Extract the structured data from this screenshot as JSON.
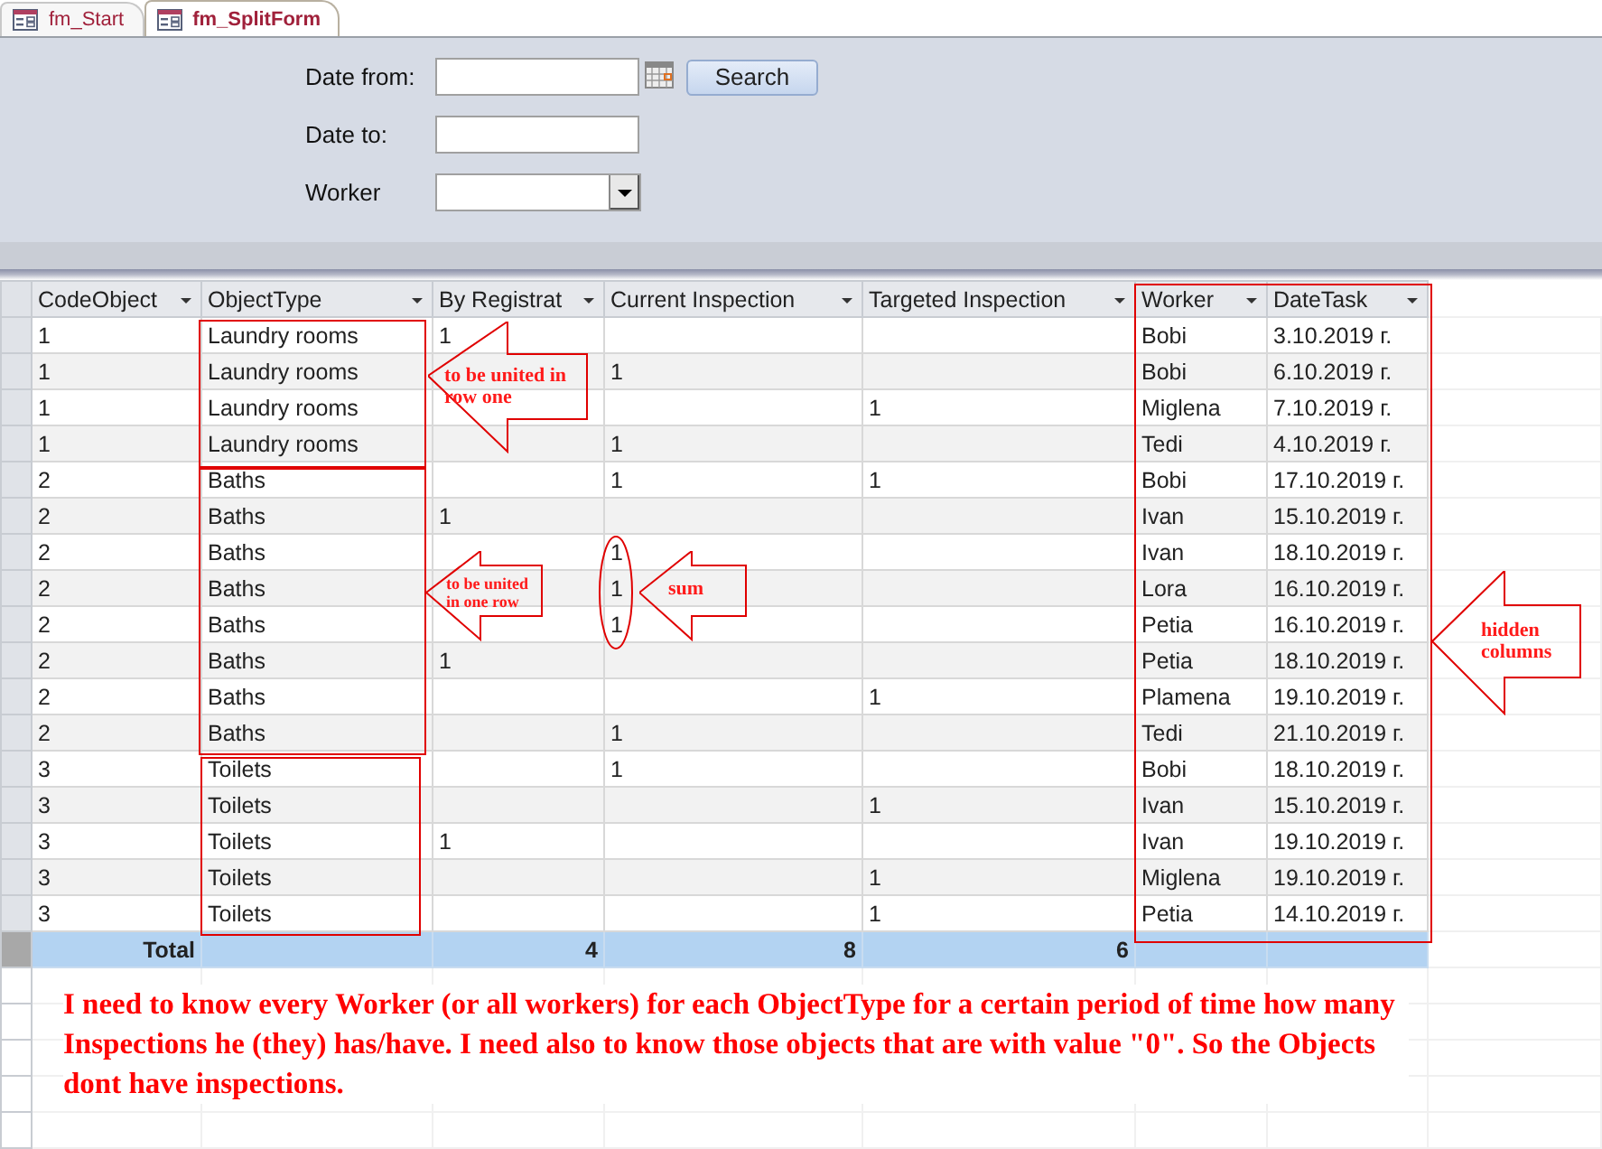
{
  "tabs": [
    {
      "label": "fm_Start",
      "selected": false
    },
    {
      "label": "fm_SplitForm",
      "selected": true
    }
  ],
  "form": {
    "date_from_label": "Date from:",
    "date_to_label": "Date to:",
    "worker_label": "Worker",
    "search_button": "Search"
  },
  "table": {
    "columns": [
      "CodeObject",
      "ObjectType",
      "By Registrat",
      "Current Inspection",
      "Targeted Inspection",
      "Worker",
      "DateTask"
    ],
    "rows": [
      [
        "1",
        "Laundry rooms",
        "1",
        "",
        "",
        "Bobi",
        "3.10.2019 г."
      ],
      [
        "1",
        "Laundry rooms",
        "",
        "1",
        "",
        "Bobi",
        "6.10.2019 г."
      ],
      [
        "1",
        "Laundry rooms",
        "",
        "",
        "1",
        "Miglena",
        "7.10.2019 г."
      ],
      [
        "1",
        "Laundry rooms",
        "",
        "1",
        "",
        "Tedi",
        "4.10.2019 г."
      ],
      [
        "2",
        "Baths",
        "",
        "1",
        "1",
        "Bobi",
        "17.10.2019 г."
      ],
      [
        "2",
        "Baths",
        "1",
        "",
        "",
        "Ivan",
        "15.10.2019 г."
      ],
      [
        "2",
        "Baths",
        "",
        "1",
        "",
        "Ivan",
        "18.10.2019 г."
      ],
      [
        "2",
        "Baths",
        "",
        "1",
        "",
        "Lora",
        "16.10.2019 г."
      ],
      [
        "2",
        "Baths",
        "",
        "1",
        "",
        "Petia",
        "16.10.2019 г."
      ],
      [
        "2",
        "Baths",
        "1",
        "",
        "",
        "Petia",
        "18.10.2019 г."
      ],
      [
        "2",
        "Baths",
        "",
        "",
        "1",
        "Plamena",
        "19.10.2019 г."
      ],
      [
        "2",
        "Baths",
        "",
        "1",
        "",
        "Tedi",
        "21.10.2019 г."
      ],
      [
        "3",
        "Toilets",
        "",
        "1",
        "",
        "Bobi",
        "18.10.2019 г."
      ],
      [
        "3",
        "Toilets",
        "",
        "",
        "1",
        "Ivan",
        "15.10.2019 г."
      ],
      [
        "3",
        "Toilets",
        "1",
        "",
        "",
        "Ivan",
        "19.10.2019 г."
      ],
      [
        "3",
        "Toilets",
        "",
        "",
        "1",
        "Miglena",
        "19.10.2019 г."
      ],
      [
        "3",
        "Toilets",
        "",
        "",
        "1",
        "Petia",
        "14.10.2019 г."
      ]
    ],
    "total": {
      "label": "Total",
      "by_registrat": "4",
      "current_inspection": "8",
      "targeted_inspection": "6"
    }
  },
  "annotations": [
    {
      "kind": "arrow",
      "text": "to be united in row one"
    },
    {
      "kind": "arrow",
      "text": "to be united in one row"
    },
    {
      "kind": "arrow",
      "text": "sum"
    },
    {
      "kind": "arrow",
      "text": "hidden columns"
    }
  ],
  "note": "I need to know every Worker (or all workers) for each ObjectType for a certain period of time how many Inspections he (they) has/have. I need also to know those objects that are with value \"0\". So the Objects dont have inspections."
}
